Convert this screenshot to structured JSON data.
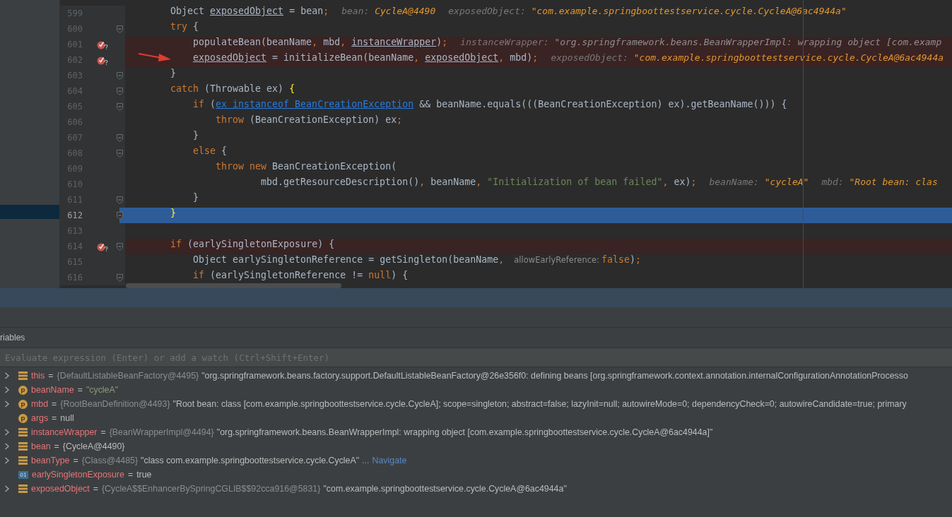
{
  "editor": {
    "lines": [
      {
        "number": "599",
        "breakpoint": false,
        "fold": false,
        "selected": false,
        "tokens": [
          {
            "text": "        Object ",
            "kind": "plain"
          },
          {
            "text": "exposedObject",
            "kind": "ul"
          },
          {
            "text": " = bean",
            "kind": "plain"
          },
          {
            "text": ";",
            "kind": "kw"
          },
          {
            "text": "bean: ",
            "kind": "hint"
          },
          {
            "text": "CycleA@4490",
            "kind": "hint-val"
          },
          {
            "text": "exposedObject: ",
            "kind": "hint"
          },
          {
            "text": "\"com.example.springboottestservice.cycle.CycleA@6ac4944a\"",
            "kind": "hint-val"
          }
        ]
      },
      {
        "number": "600",
        "breakpoint": false,
        "fold": true,
        "selected": false,
        "tokens": [
          {
            "text": "        try",
            "kind": "kw"
          },
          {
            "text": " {",
            "kind": "plain"
          }
        ]
      },
      {
        "number": "601",
        "breakpoint": true,
        "fold": false,
        "selected": false,
        "tokens": [
          {
            "text": "            populateBean(beanName",
            "kind": "plain"
          },
          {
            "text": ", ",
            "kind": "kw"
          },
          {
            "text": "mbd",
            "kind": "plain"
          },
          {
            "text": ", ",
            "kind": "kw"
          },
          {
            "text": "instanceWrapper",
            "kind": "ul"
          },
          {
            "text": ")",
            "kind": "plain"
          },
          {
            "text": ";",
            "kind": "kw"
          },
          {
            "text": "instanceWrapper: ",
            "kind": "hint"
          },
          {
            "text": "\"org.springframework.beans.BeanWrapperImpl: wrapping object [com.examp",
            "kind": "hint-dim"
          }
        ]
      },
      {
        "number": "602",
        "breakpoint": true,
        "fold": false,
        "selected": false,
        "tokens": [
          {
            "text": "            exposedObject",
            "kind": "ul"
          },
          {
            "text": " = initializeBean(beanName",
            "kind": "plain"
          },
          {
            "text": ", ",
            "kind": "kw"
          },
          {
            "text": "exposedObject",
            "kind": "ul"
          },
          {
            "text": ", ",
            "kind": "kw"
          },
          {
            "text": "mbd)",
            "kind": "plain"
          },
          {
            "text": ";",
            "kind": "kw"
          },
          {
            "text": "exposedObject: ",
            "kind": "hint"
          },
          {
            "text": "\"com.example.springboottestservice.cycle.CycleA@6ac4944a",
            "kind": "hint-val"
          }
        ]
      },
      {
        "number": "603",
        "breakpoint": false,
        "fold": true,
        "selected": false,
        "tokens": [
          {
            "text": "        }",
            "kind": "plain"
          }
        ]
      },
      {
        "number": "604",
        "breakpoint": false,
        "fold": true,
        "selected": false,
        "tokens": [
          {
            "text": "        catch",
            "kind": "kw"
          },
          {
            "text": " (Throwable ex) ",
            "kind": "plain"
          },
          {
            "text": "{",
            "kind": "brace"
          }
        ]
      },
      {
        "number": "605",
        "breakpoint": false,
        "fold": true,
        "selected": false,
        "tokens": [
          {
            "text": "            if",
            "kind": "kw"
          },
          {
            "text": " (",
            "kind": "plain"
          },
          {
            "text": "ex instanceof BeanCreationException",
            "kind": "link"
          },
          {
            "text": " && beanName.equals(((BeanCreationException) ex).getBeanName())) {",
            "kind": "plain"
          }
        ]
      },
      {
        "number": "606",
        "breakpoint": false,
        "fold": false,
        "selected": false,
        "tokens": [
          {
            "text": "                throw",
            "kind": "kw"
          },
          {
            "text": " (BeanCreationException) ex",
            "kind": "plain"
          },
          {
            "text": ";",
            "kind": "kw"
          }
        ]
      },
      {
        "number": "607",
        "breakpoint": false,
        "fold": true,
        "selected": false,
        "tokens": [
          {
            "text": "            }",
            "kind": "plain"
          }
        ]
      },
      {
        "number": "608",
        "breakpoint": false,
        "fold": true,
        "selected": false,
        "tokens": [
          {
            "text": "            else",
            "kind": "kw"
          },
          {
            "text": " {",
            "kind": "plain"
          }
        ]
      },
      {
        "number": "609",
        "breakpoint": false,
        "fold": false,
        "selected": false,
        "tokens": [
          {
            "text": "                throw new",
            "kind": "kw"
          },
          {
            "text": " BeanCreationException(",
            "kind": "plain"
          }
        ]
      },
      {
        "number": "610",
        "breakpoint": false,
        "fold": false,
        "selected": false,
        "tokens": [
          {
            "text": "                        mbd.getResourceDescription()",
            "kind": "plain"
          },
          {
            "text": ", ",
            "kind": "kw"
          },
          {
            "text": "beanName",
            "kind": "plain"
          },
          {
            "text": ", ",
            "kind": "kw"
          },
          {
            "text": "\"Initialization of bean failed\"",
            "kind": "str"
          },
          {
            "text": ", ",
            "kind": "kw"
          },
          {
            "text": "ex)",
            "kind": "plain"
          },
          {
            "text": ";",
            "kind": "kw"
          },
          {
            "text": "beanName: ",
            "kind": "hint"
          },
          {
            "text": "\"cycleA\"",
            "kind": "hint-val"
          },
          {
            "text": "mbd: ",
            "kind": "hint"
          },
          {
            "text": "\"Root bean: clas",
            "kind": "hint-val"
          }
        ]
      },
      {
        "number": "611",
        "breakpoint": false,
        "fold": true,
        "selected": false,
        "tokens": [
          {
            "text": "            }",
            "kind": "plain"
          }
        ]
      },
      {
        "number": "612",
        "breakpoint": false,
        "fold": true,
        "selected": true,
        "tokens": [
          {
            "text": "        }",
            "kind": "brace"
          }
        ]
      },
      {
        "number": "613",
        "breakpoint": false,
        "fold": false,
        "selected": false
      },
      {
        "number": "614",
        "breakpoint": true,
        "fold": true,
        "selected": false,
        "tokens": [
          {
            "text": "        if",
            "kind": "kw"
          },
          {
            "text": " (earlySingletonExposure) {",
            "kind": "plain"
          }
        ]
      },
      {
        "number": "615",
        "breakpoint": false,
        "fold": false,
        "selected": false,
        "tokens": [
          {
            "text": "            Object earlySingletonReference = getSingleton(beanName",
            "kind": "plain"
          },
          {
            "text": ", ",
            "kind": "kw"
          },
          {
            "text": "allowEarlyReference:",
            "kind": "inlay"
          },
          {
            "text": "false",
            "kind": "kw"
          },
          {
            "text": ")",
            "kind": "plain"
          },
          {
            "text": ";",
            "kind": "kw"
          }
        ]
      },
      {
        "number": "616",
        "breakpoint": false,
        "fold": true,
        "selected": false,
        "tokens": [
          {
            "text": "            if",
            "kind": "kw"
          },
          {
            "text": " (earlySingletonReference != ",
            "kind": "plain"
          },
          {
            "text": "null",
            "kind": "kw"
          },
          {
            "text": ") {",
            "kind": "plain"
          }
        ]
      }
    ]
  },
  "variables_panel": {
    "title": "riables",
    "evaluate": {
      "placeholder": "Evaluate expression (Enter) or add a watch (Ctrl+Shift+Enter)"
    },
    "rows": [
      {
        "expandable": true,
        "kind": "field",
        "name": "this",
        "eq": "=",
        "type": "{DefaultListableBeanFactory@4495}",
        "value": "\"org.springframework.beans.factory.support.DefaultListableBeanFactory@26e356f0: defining beans [org.springframework.context.annotation.internalConfigurationAnnotationProcesso",
        "quoted_string": false
      },
      {
        "expandable": true,
        "kind": "param",
        "badge": "p",
        "name": "beanName",
        "eq": "=",
        "value": "\"cycleA\"",
        "quoted_string": true
      },
      {
        "expandable": true,
        "kind": "param",
        "badge": "p",
        "name": "mbd",
        "eq": "=",
        "type": "{RootBeanDefinition@4493}",
        "value": "\"Root bean: class [com.example.springboottestservice.cycle.CycleA]; scope=singleton; abstract=false; lazyInit=null; autowireMode=0; dependencyCheck=0; autowireCandidate=true; primary",
        "quoted_string": false
      },
      {
        "expandable": false,
        "kind": "param",
        "badge": "p",
        "name": "args",
        "eq": "=",
        "value": "null",
        "quoted_string": false
      },
      {
        "expandable": true,
        "kind": "field",
        "name": "instanceWrapper",
        "eq": "=",
        "type": "{BeanWrapperImpl@4494}",
        "value": "\"org.springframework.beans.BeanWrapperImpl: wrapping object [com.example.springboottestservice.cycle.CycleA@6ac4944a]\"",
        "quoted_string": false
      },
      {
        "expandable": true,
        "kind": "field",
        "name": "bean",
        "eq": "=",
        "value": "{CycleA@4490}",
        "quoted_string": false
      },
      {
        "expandable": true,
        "kind": "field",
        "name": "beanType",
        "eq": "=",
        "type": "{Class@4485}",
        "value": "\"class com.example.springboottestservice.cycle.CycleA\"",
        "quoted_string": false,
        "more": "...",
        "link": "Navigate"
      },
      {
        "expandable": false,
        "kind": "bool",
        "badge": "01",
        "name": "earlySingletonExposure",
        "eq": "=",
        "value": "true",
        "quoted_string": false
      },
      {
        "expandable": true,
        "kind": "field",
        "name": "exposedObject",
        "eq": "=",
        "type": "{CycleA$$EnhancerBySpringCGLIB$$92cca916@5831}",
        "value": "\"com.example.springboottestservice.cycle.CycleA@6ac4944a\"",
        "quoted_string": false
      }
    ]
  }
}
